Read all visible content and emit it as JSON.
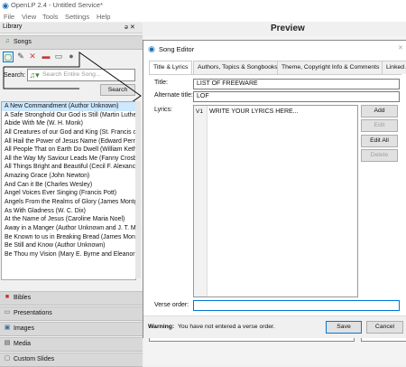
{
  "window": {
    "title": "OpenLP 2.4 - Untitled Service*"
  },
  "menu": [
    "File",
    "View",
    "Tools",
    "Settings",
    "Help"
  ],
  "library": {
    "header": "Library",
    "header_controls": "ə ✕",
    "songs_label": "Songs",
    "search_label": "Search:",
    "search_placeholder": "Search Entire Song...",
    "search_button": "Search",
    "songs": [
      "A New Commandment (Author Unknown)",
      "A Safe Stronghold Our God is Still (Martin Luthe",
      "Abide With Me (W. H. Monk)",
      "All Creatures of our God and King (St. Francis of",
      "All Hail the Power of Jesus Name (Edward Perro",
      "All People That on Earth Do Dwell (William Keth",
      "All the Way My Saviour Leads Me (Fanny Crosb",
      "All Things Bright and Beautiful (Cecil F. Alexanc",
      "Amazing Grace (John Newton)",
      "And Can it Be (Charles Wesley)",
      "Angel Voices Ever Singing (Francis Pott)",
      "Angels From the Realms of Glory (James Montg",
      "As With Gladness (W. C. Dix)",
      "At the Name of Jesus (Caroline Maria Noel)",
      "Away in a Manger (Author Unknown and J. T. M",
      "Be Known to us in Breaking Bread (James Mont",
      "Be Still and Know (Author Unknown)",
      "Be Thou my Vision (Mary E. Byrne and Eleanor I"
    ],
    "sections": [
      "Bibles",
      "Presentations",
      "Images",
      "Media",
      "Custom Slides"
    ]
  },
  "preview": {
    "title": "Preview"
  },
  "dialog": {
    "title": "Song Editor",
    "tabs": [
      "Title & Lyrics",
      "Authors, Topics & Songbooks",
      "Theme, Copyright Info & Comments",
      "Linked A"
    ],
    "title_label": "Title:",
    "title_value": "LIST OF FREEWARE",
    "alt_title_label": "Alternate title:",
    "alt_title_value": "LOF",
    "lyrics_label": "Lyrics:",
    "lyrics_verse": "V1",
    "lyrics_text": "WRITE YOUR LYRICS HERE...",
    "buttons": {
      "add": "Add",
      "edit": "Edit",
      "edit_all": "Edit All",
      "delete": "Delete"
    },
    "verse_order_label": "Verse order:",
    "warning_bold": "Warning:",
    "warning_text": "You have not entered a verse order.",
    "save": "Save",
    "cancel": "Cancel"
  },
  "colors": {
    "selection": "#cde8ff",
    "accent": "#0078d7",
    "danger_icon": "#d83b3b"
  }
}
